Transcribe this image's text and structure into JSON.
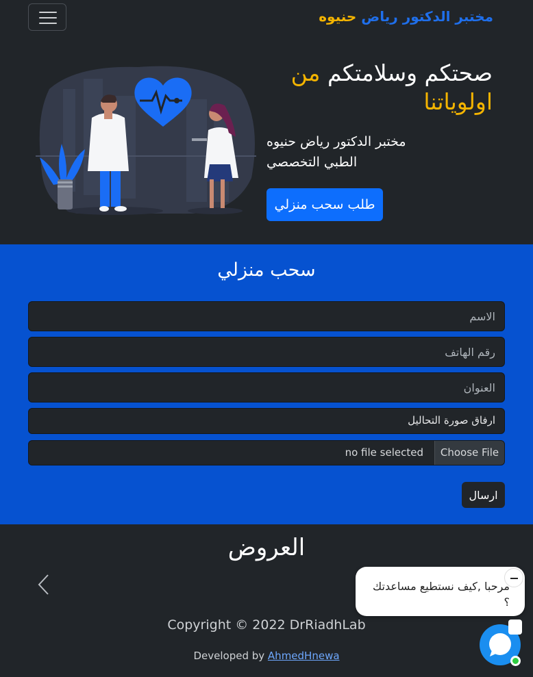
{
  "nav": {
    "brand_part1": "مختبر الدكتور رياض",
    "brand_part2": "حنيوه"
  },
  "hero": {
    "title_main": "صحتكم وسلامتكم",
    "title_highlight_1": "من",
    "title_highlight_2": "اولوياتنا",
    "subtitle_line1": "مختبر الدكتور رياض حنيوه",
    "subtitle_line2": "الطبي التخصصي",
    "button_label": "طلب سحب منزلي"
  },
  "form": {
    "title": "سحب منزلي",
    "name_placeholder": "الاسم",
    "phone_placeholder": "رقم الهاتف",
    "address_placeholder": "العنوان",
    "attach_label": "ارفاق صورة التحاليل",
    "file_button": "Choose File",
    "file_status": "no file selected",
    "submit_label": "ارسال"
  },
  "offers": {
    "title": "العروض"
  },
  "footer": {
    "copyright": "Copyright © 2022 DrRiadhLab",
    "developed_by": "Developed by",
    "developer_link": "AhmedHnewa"
  },
  "chat": {
    "message": "مرحبا ,كيف نستطيع مساعدتك ؟"
  },
  "colors": {
    "dark_bg": "#212529",
    "primary_blue": "#0d6efd",
    "form_bg": "#0652d0",
    "accent_yellow": "#f4b400"
  },
  "icons": [
    "hamburger-menu-icon",
    "chevron-left-icon",
    "minimize-icon",
    "chat-icon"
  ]
}
